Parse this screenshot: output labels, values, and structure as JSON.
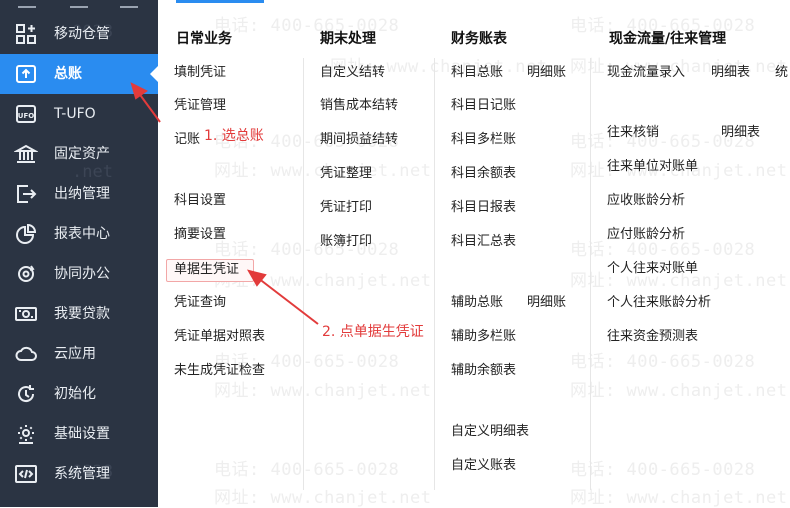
{
  "sidebar": {
    "items": [
      {
        "label": "移动仓管",
        "icon": "grid-plus-icon"
      },
      {
        "label": "总账",
        "icon": "ledger-up-icon"
      },
      {
        "label": "T-UFO",
        "icon": "ufo-icon"
      },
      {
        "label": "固定资产",
        "icon": "bank-icon"
      },
      {
        "label": "出纳管理",
        "icon": "cashier-exit-icon"
      },
      {
        "label": "报表中心",
        "icon": "pie-chart-icon"
      },
      {
        "label": "协同办公",
        "icon": "sync-icon"
      },
      {
        "label": "我要贷款",
        "icon": "money-icon"
      },
      {
        "label": "云应用",
        "icon": "cloud-icon"
      },
      {
        "label": "初始化",
        "icon": "clock-icon"
      },
      {
        "label": "基础设置",
        "icon": "gear-icon"
      },
      {
        "label": "系统管理",
        "icon": "code-icon"
      }
    ],
    "active_index": 1
  },
  "menu": {
    "daily": {
      "title": "日常业务",
      "items": [
        "填制凭证",
        "凭证管理",
        "记账",
        "科目设置",
        "摘要设置",
        "单据生凭证",
        "凭证查询",
        "凭证单据对照表",
        "未生成凭证检查"
      ]
    },
    "period_end": {
      "title": "期末处理",
      "items": [
        "自定义结转",
        "销售成本结转",
        "期间损益结转",
        "凭证整理",
        "凭证打印",
        "账簿打印"
      ]
    },
    "financial": {
      "title": "财务账表",
      "items": [
        "科目总账",
        "明细账",
        "科目日记账",
        "科目多栏账",
        "科目余额表",
        "科目日报表",
        "科目汇总表",
        "辅助总账",
        "明细账",
        "辅助多栏账",
        "辅助余额表",
        "自定义明细表",
        "自定义账表"
      ]
    },
    "cashflow": {
      "title": "现金流量/往来管理",
      "items": [
        "现金流量录入",
        "明细表",
        "统",
        "往来核销",
        "明细表",
        "往来单位对账单",
        "应收账龄分析",
        "应付账龄分析",
        "个人往来对账单",
        "个人往来账龄分析",
        "往来资金预测表"
      ]
    }
  },
  "annotations": {
    "step1": "1. 选总账",
    "step2": "2. 点单据生凭证"
  },
  "watermark": {
    "phone": "电话: 400-665-0028",
    "site": "网址: www.chanjet.net"
  },
  "colors": {
    "sidebar_bg": "#2b3443",
    "active": "#2a8cf0",
    "annotation": "#e23b3b"
  }
}
